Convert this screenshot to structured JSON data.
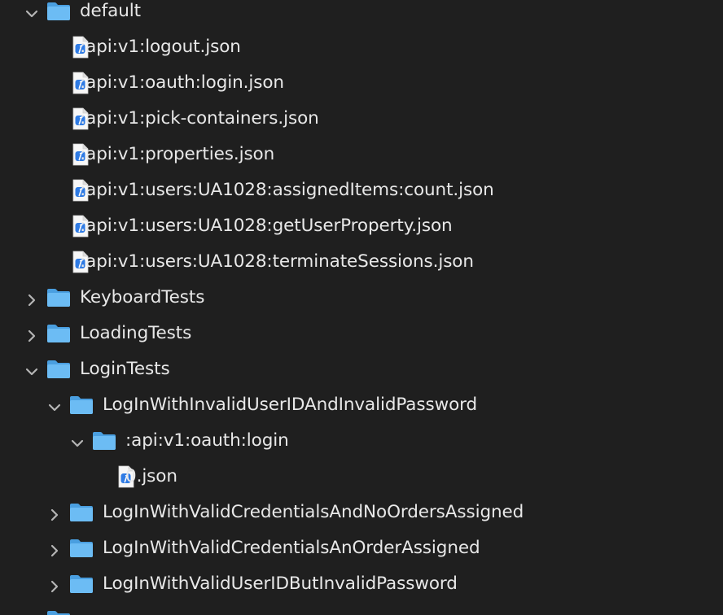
{
  "tree": {
    "rows": [
      {
        "label": "default",
        "kind": "folder",
        "depth": 0,
        "expanded": true,
        "icon": "folder-icon"
      },
      {
        "label": ":api:v1:logout.json",
        "kind": "file",
        "depth": 1,
        "icon": "json-file-icon"
      },
      {
        "label": ":api:v1:oauth:login.json",
        "kind": "file",
        "depth": 1,
        "icon": "json-file-icon"
      },
      {
        "label": ":api:v1:pick-containers.json",
        "kind": "file",
        "depth": 1,
        "icon": "json-file-icon"
      },
      {
        "label": ":api:v1:properties.json",
        "kind": "file",
        "depth": 1,
        "icon": "json-file-icon"
      },
      {
        "label": ":api:v1:users:UA1028:assignedItems:count.json",
        "kind": "file",
        "depth": 1,
        "icon": "json-file-icon"
      },
      {
        "label": ":api:v1:users:UA1028:getUserProperty.json",
        "kind": "file",
        "depth": 1,
        "icon": "json-file-icon"
      },
      {
        "label": ":api:v1:users:UA1028:terminateSessions.json",
        "kind": "file",
        "depth": 1,
        "icon": "json-file-icon"
      },
      {
        "label": "KeyboardTests",
        "kind": "folder",
        "depth": 0,
        "expanded": false,
        "icon": "folder-icon"
      },
      {
        "label": "LoadingTests",
        "kind": "folder",
        "depth": 0,
        "expanded": false,
        "icon": "folder-icon"
      },
      {
        "label": "LoginTests",
        "kind": "folder",
        "depth": 0,
        "expanded": true,
        "icon": "folder-icon"
      },
      {
        "label": "LogInWithInvalidUserIDAndInvalidPassword",
        "kind": "folder",
        "depth": 1,
        "expanded": true,
        "icon": "folder-icon"
      },
      {
        "label": ":api:v1:oauth:login",
        "kind": "folder",
        "depth": 2,
        "expanded": true,
        "icon": "folder-icon"
      },
      {
        "label": "0.json",
        "kind": "file",
        "depth": 3,
        "icon": "json-file-icon"
      },
      {
        "label": "LogInWithValidCredentialsAndNoOrdersAssigned",
        "kind": "folder",
        "depth": 1,
        "expanded": false,
        "icon": "folder-icon"
      },
      {
        "label": "LogInWithValidCredentialsAnOrderAssigned",
        "kind": "folder",
        "depth": 1,
        "expanded": false,
        "icon": "folder-icon"
      },
      {
        "label": "LogInWithValidUserIDButInvalidPassword",
        "kind": "folder",
        "depth": 1,
        "expanded": false,
        "icon": "folder-icon"
      },
      {
        "label": "",
        "kind": "folder",
        "depth": 0,
        "expanded": false,
        "icon": "folder-icon"
      }
    ]
  },
  "colors": {
    "background": "#1f1f1f",
    "text": "#e8e8e8",
    "chevron": "#b5b5b5",
    "folder_back": "#4a9fe0",
    "folder_front": "#6cbcf4",
    "file_page": "#f7f7f7",
    "file_badge": "#2f7be4"
  }
}
